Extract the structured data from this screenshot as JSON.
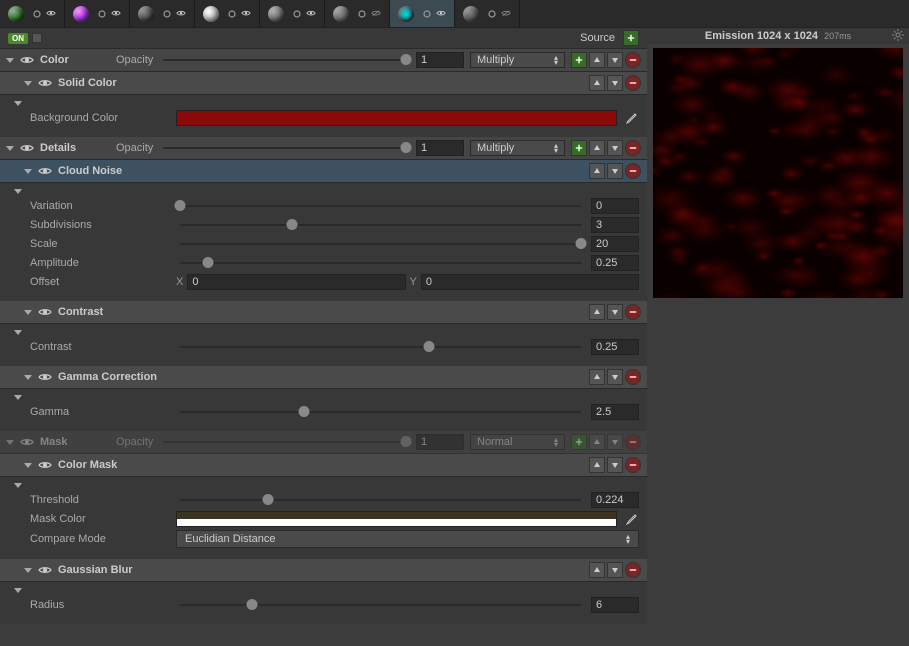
{
  "tabs": [
    {
      "color": "radial-gradient(circle at 35% 35%, #8a8 0%, #262 60%, #030 100%)"
    },
    {
      "color": "radial-gradient(circle at 35% 35%, #f8f 0%, #a3d 50%, #42a 100%)"
    },
    {
      "color": "radial-gradient(circle at 35% 35%, #888 0%, #444 60%, #222 100%)"
    },
    {
      "color": "radial-gradient(circle at 35% 35%, #fff 0%, #bbb 50%, #888 100%)"
    },
    {
      "color": "radial-gradient(circle at 35% 35%, #aaa 0%, #666 60%, #333 100%)"
    },
    {
      "color": "radial-gradient(circle at 35% 35%, #999 0%, #666 60%, #333 100%)"
    },
    {
      "color": "radial-gradient(circle at 50% 50%, #0dd 0%, #0aa 40%, transparent 60%)",
      "active": true
    },
    {
      "color": "radial-gradient(circle at 35% 35%, #888 0%, #555 60%, #333 100%)"
    }
  ],
  "source_bar": {
    "on": "ON",
    "source": "Source"
  },
  "sections": {
    "color": {
      "title": "Color",
      "opacity_label": "Opacity",
      "opacity_val": "1",
      "blend": "Multiply",
      "solid_color": {
        "title": "Solid Color",
        "bg_label": "Background Color",
        "bg_color": "#8a0a0a"
      }
    },
    "details": {
      "title": "Details",
      "opacity_label": "Opacity",
      "opacity_val": "1",
      "blend": "Multiply",
      "cloud": {
        "title": "Cloud Noise",
        "variation": {
          "label": "Variation",
          "val": "0",
          "pos": 0
        },
        "subdivisions": {
          "label": "Subdivisions",
          "val": "3",
          "pos": 28
        },
        "scale": {
          "label": "Scale",
          "val": "20",
          "pos": 100
        },
        "amplitude": {
          "label": "Amplitude",
          "val": "0.25",
          "pos": 7
        },
        "offset": {
          "label": "Offset",
          "x": "0",
          "y": "0"
        }
      },
      "contrast": {
        "title": "Contrast",
        "label": "Contrast",
        "val": "0.25",
        "pos": 62
      },
      "gamma": {
        "title": "Gamma Correction",
        "label": "Gamma",
        "val": "2.5",
        "pos": 31
      }
    },
    "mask": {
      "title": "Mask",
      "opacity_label": "Opacity",
      "opacity_val": "1",
      "blend": "Normal",
      "colormask": {
        "title": "Color Mask",
        "threshold": {
          "label": "Threshold",
          "val": "0.224",
          "pos": 22
        },
        "maskcolor": {
          "label": "Mask Color",
          "color": "linear-gradient(to bottom, #3a3320 50%, #fff 50%)"
        },
        "compare": {
          "label": "Compare Mode",
          "val": "Euclidian Distance"
        }
      },
      "blur": {
        "title": "Gaussian Blur",
        "radius": {
          "label": "Radius",
          "val": "6",
          "pos": 18
        }
      }
    }
  },
  "preview": {
    "title": "Emission 1024 x 1024",
    "ms": "207ms"
  }
}
